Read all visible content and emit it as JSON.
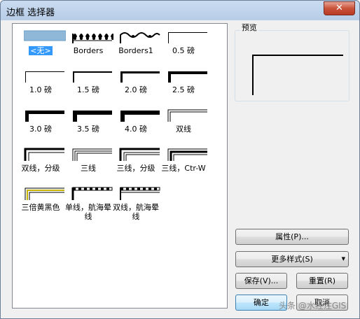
{
  "window": {
    "title": "边框 选择器",
    "close_label": "✕"
  },
  "borders": [
    {
      "label": "<无>",
      "style": "none"
    },
    {
      "label": "Borders",
      "style": "decor1"
    },
    {
      "label": "Borders1",
      "style": "decor2"
    },
    {
      "label": "0.5 磅",
      "style": "w1"
    },
    {
      "label": "1.0 磅",
      "style": "w1"
    },
    {
      "label": "1.5 磅",
      "style": "w2"
    },
    {
      "label": "2.0 磅",
      "style": "w3"
    },
    {
      "label": "2.5 磅",
      "style": "w4"
    },
    {
      "label": "3.0 磅",
      "style": "w5"
    },
    {
      "label": "3.5 磅",
      "style": "w6"
    },
    {
      "label": "4.0 磅",
      "style": "w6"
    },
    {
      "label": "双线",
      "style": "double"
    },
    {
      "label": "双线，分级",
      "style": "doublegrad"
    },
    {
      "label": "三线",
      "style": "triple"
    },
    {
      "label": "三线，分级",
      "style": "triplegrad"
    },
    {
      "label": "三线，Ctr-W",
      "style": "triplectr"
    },
    {
      "label": "三倍黄黑色",
      "style": "yellow"
    },
    {
      "label": "单线，航海晕线",
      "style": "naut1"
    },
    {
      "label": "双线，航海晕线",
      "style": "naut2"
    }
  ],
  "selected_index": 0,
  "preview": {
    "label": "预览"
  },
  "buttons": {
    "properties": "属性(P)...",
    "more_styles": "更多样式(S)",
    "save": "保存(V)...",
    "reset": "重置(R)",
    "ok": "确定",
    "cancel": "取消"
  },
  "watermark": "头条 @水经注GIS"
}
